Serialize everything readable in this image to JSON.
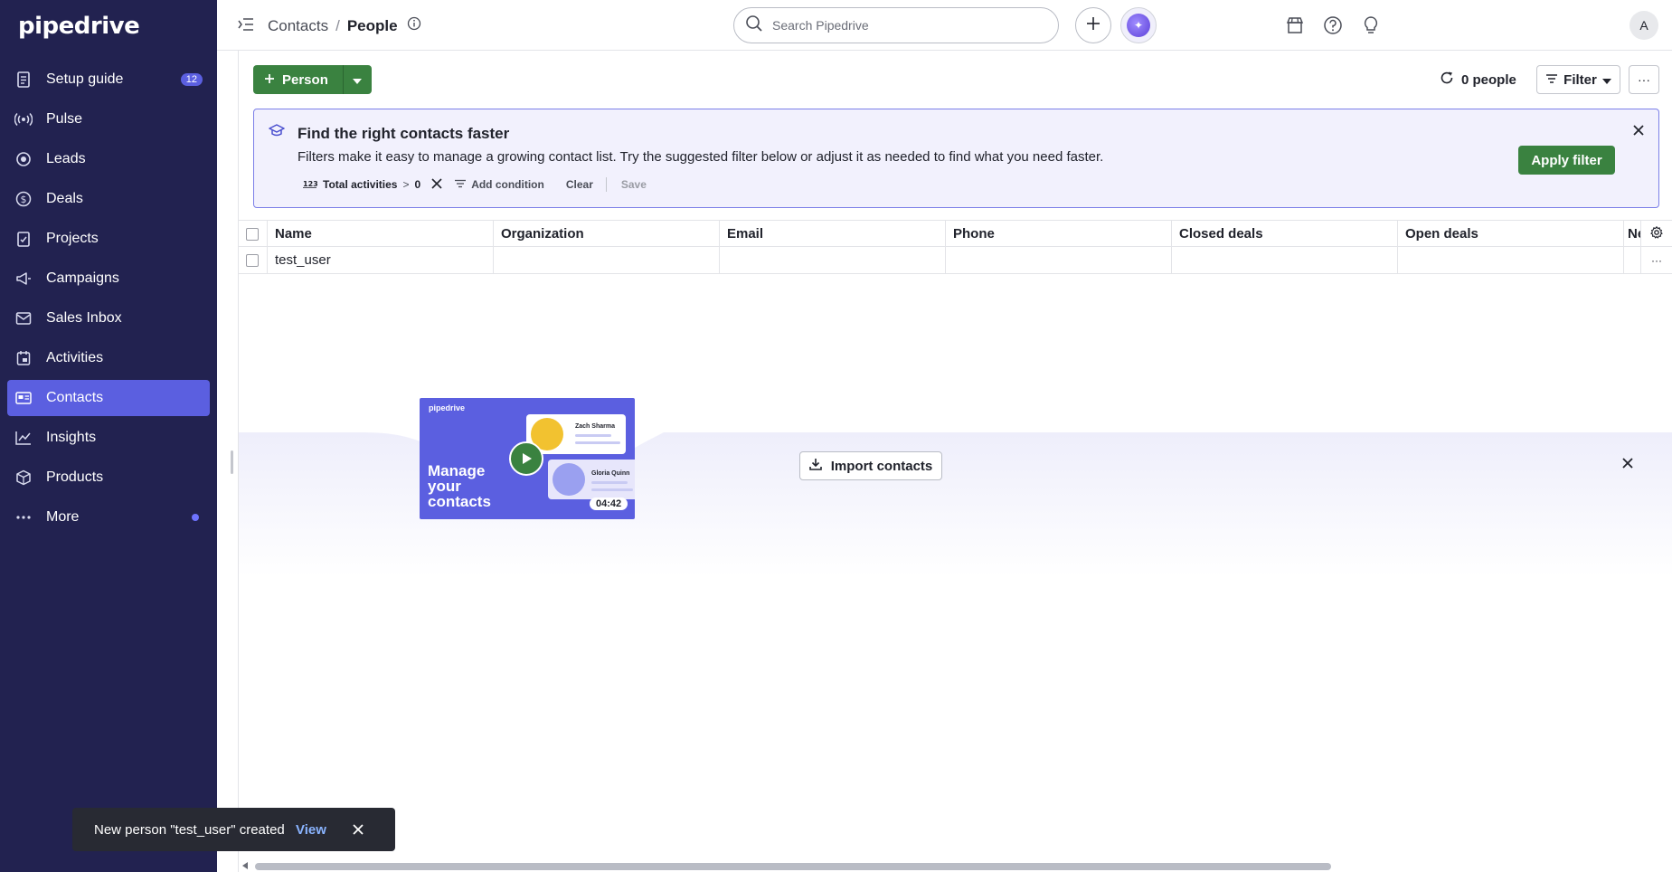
{
  "app": {
    "logo": "pipedrive"
  },
  "sidebar": {
    "items": [
      {
        "label": "Setup guide",
        "icon": "checklist-icon",
        "badge": "12"
      },
      {
        "label": "Pulse",
        "icon": "pulse-icon"
      },
      {
        "label": "Leads",
        "icon": "target-icon"
      },
      {
        "label": "Deals",
        "icon": "dollar-icon"
      },
      {
        "label": "Projects",
        "icon": "clipboard-icon"
      },
      {
        "label": "Campaigns",
        "icon": "megaphone-icon"
      },
      {
        "label": "Sales Inbox",
        "icon": "inbox-icon"
      },
      {
        "label": "Activities",
        "icon": "calendar-icon"
      },
      {
        "label": "Contacts",
        "icon": "contacts-card-icon",
        "active": true
      },
      {
        "label": "Insights",
        "icon": "chart-icon"
      },
      {
        "label": "Products",
        "icon": "box-icon"
      },
      {
        "label": "More",
        "icon": "ellipsis-icon",
        "dot": true
      }
    ]
  },
  "header": {
    "breadcrumb_parent": "Contacts",
    "breadcrumb_sep": "/",
    "breadcrumb_current": "People",
    "search_placeholder": "Search Pipedrive",
    "avatar_initial": "A"
  },
  "toolbar": {
    "add_label": "Person",
    "people_count": "0 people",
    "filter_label": "Filter",
    "more_label": "···"
  },
  "banner": {
    "title": "Find the right contacts faster",
    "text": "Filters make it easy to manage a growing contact list. Try the suggested filter below or adjust it as needed to find what you need faster.",
    "condition_field": "Total activities",
    "condition_op": ">",
    "condition_value": "0",
    "add_condition": "Add condition",
    "clear": "Clear",
    "save": "Save",
    "apply": "Apply filter"
  },
  "table": {
    "columns": [
      "Name",
      "Organization",
      "Email",
      "Phone",
      "Closed deals",
      "Open deals",
      "Ne"
    ],
    "rows": [
      {
        "name": "test_user",
        "organization": "",
        "email": "",
        "phone": "",
        "closed_deals": "",
        "open_deals": ""
      }
    ],
    "row_more": "···"
  },
  "empty_state": {
    "video_brand": "pipedrive",
    "video_title_1": "Manage",
    "video_title_2": "your",
    "video_title_3": "contacts",
    "video_card_1": "Zach Sharma",
    "video_card_2": "Gloria Quinn",
    "video_duration": "04:42",
    "import_label": "Import contacts"
  },
  "toast": {
    "message": "New person \"test_user\" created",
    "action": "View"
  },
  "colors": {
    "sidebar_bg": "#222250",
    "accent": "#5b5fe0",
    "primary_green": "#3a8240",
    "banner_bg": "#f2f1fd"
  }
}
